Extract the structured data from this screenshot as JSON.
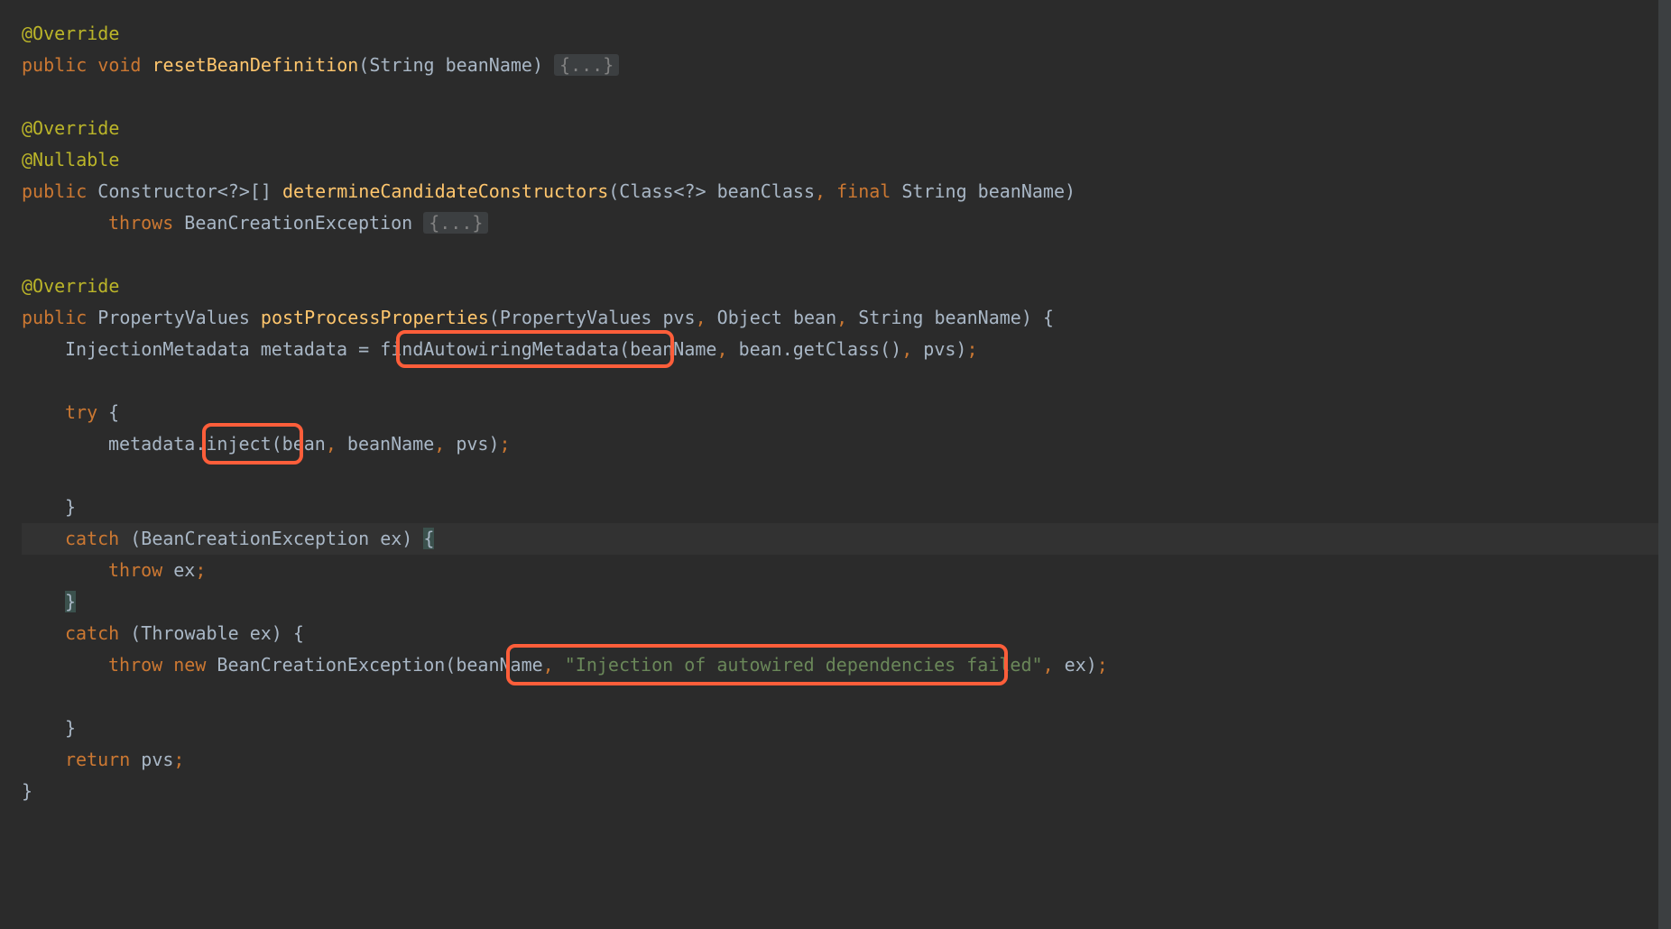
{
  "lines": {
    "override1": "@Override",
    "resetBean_public": "public",
    "resetBean_void": "void",
    "resetBean_method": "resetBeanDefinition",
    "resetBean_params": "(String beanName) ",
    "resetBean_folded": "{...}",
    "override2": "@Override",
    "nullable": "@Nullable",
    "determine_public": "public",
    "determine_return": " Constructor<?>[] ",
    "determine_method": "determineCandidateConstructors",
    "determine_params1": "(Class<?> beanClass",
    "determine_comma1": ", ",
    "determine_final": "final",
    "determine_params2": " String beanName)",
    "determine_throws": "throws",
    "determine_exc": " BeanCreationException ",
    "determine_folded": "{...}",
    "override3": "@Override",
    "ppp_public": "public",
    "ppp_return": " PropertyValues ",
    "ppp_method": "postProcessProperties",
    "ppp_params": "(PropertyValues pvs",
    "ppp_comma1": ", ",
    "ppp_params2": "Object bean",
    "ppp_comma2": ", ",
    "ppp_params3": "String beanName) {",
    "inj_line": "InjectionMetadata metadata = findAutowiringMetadata(beanName",
    "inj_comma1": ", ",
    "inj_rest": "bean.getClass()",
    "inj_comma2": ", ",
    "inj_rest2": "pvs)",
    "inj_semi": ";",
    "try_kw": "try",
    "try_brace": " {",
    "inject_line": "metadata.inject(bean",
    "inject_comma1": ", ",
    "inject_rest": "beanName",
    "inject_comma2": ", ",
    "inject_rest2": "pvs)",
    "inject_semi": ";",
    "close_brace1": "}",
    "catch1_kw": "catch",
    "catch1_params": " (BeanCreationException ex) ",
    "catch1_brace": "{",
    "throw1_kw": "throw",
    "throw1_rest": " ex",
    "throw1_semi": ";",
    "close_brace2": "}",
    "catch2_kw": "catch",
    "catch2_params": " (Throwable ex) {",
    "throw2_kw": "throw new",
    "throw2_rest": " BeanCreationException(beanName",
    "throw2_comma1": ", ",
    "throw2_string": "\"Injection of autowired dependencies failed\"",
    "throw2_comma2": ", ",
    "throw2_rest2": "ex)",
    "throw2_semi": ";",
    "close_brace3": "}",
    "return_kw": "return",
    "return_rest": " pvs",
    "return_semi": ";",
    "close_brace4": "}"
  }
}
